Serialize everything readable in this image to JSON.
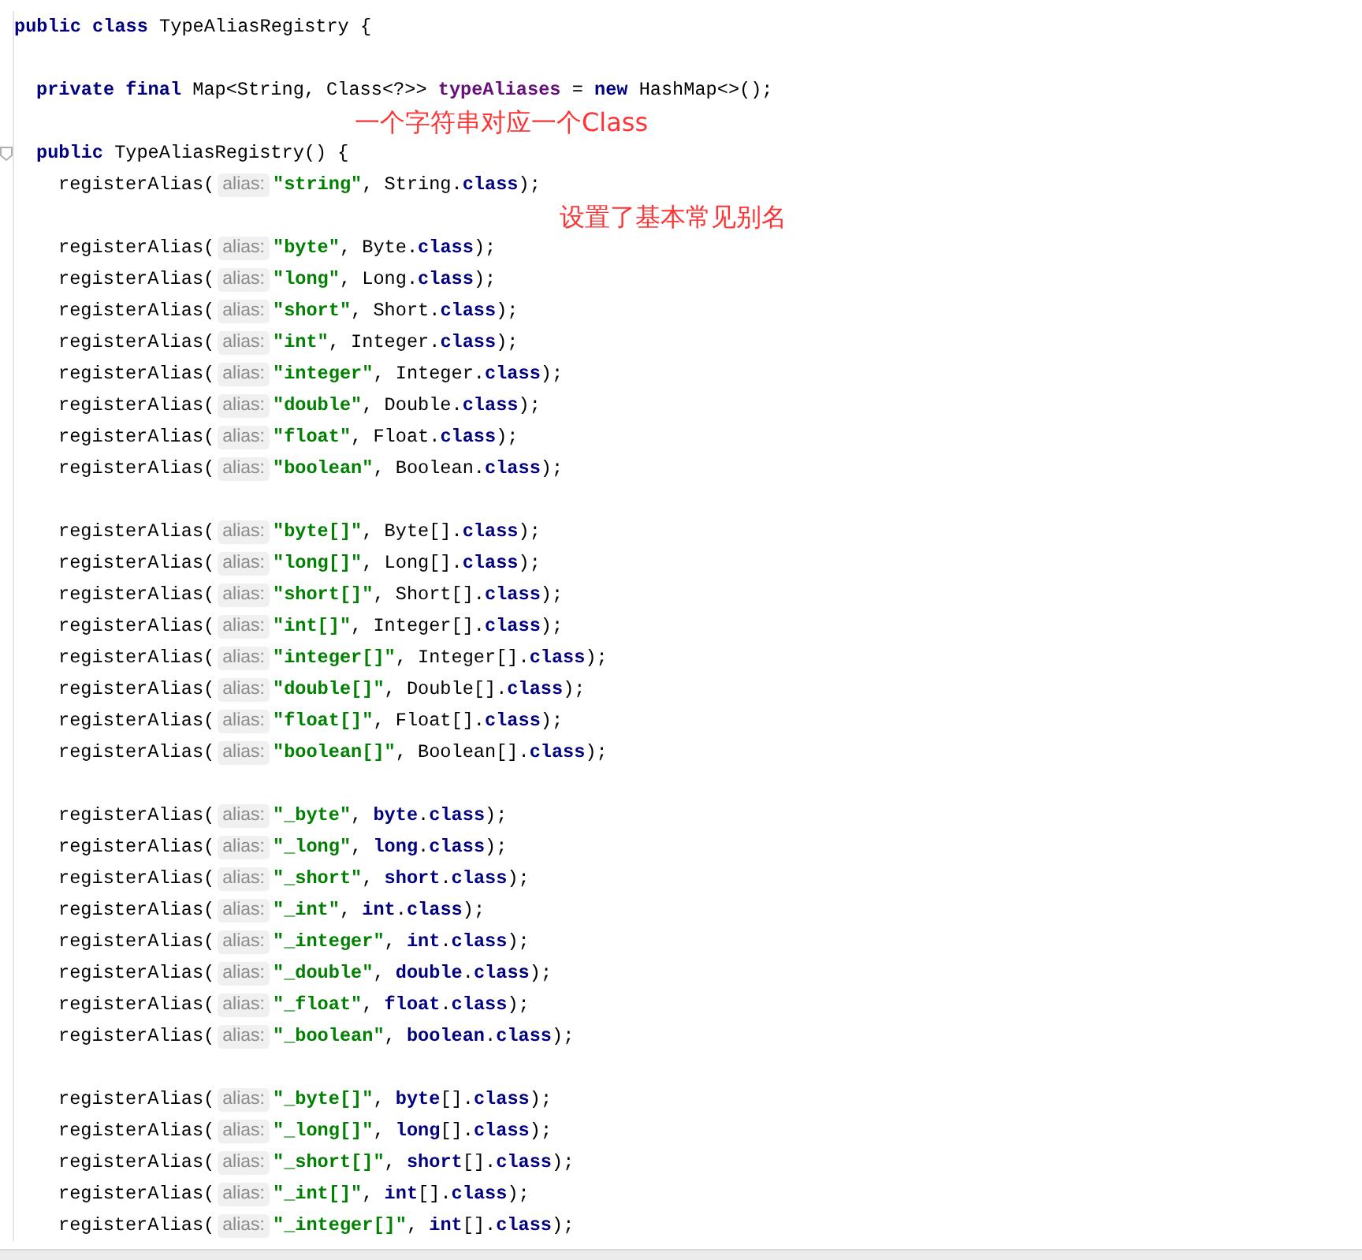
{
  "lines": [
    {
      "kind": "decl",
      "parts": [
        {
          "kind": "keyword",
          "t": "public class"
        },
        {
          "kind": "plain",
          "t": " TypeAliasRegistry {"
        }
      ]
    },
    {
      "kind": "blank"
    },
    {
      "kind": "member",
      "parts": [
        {
          "kind": "keyword",
          "t": "private final"
        },
        {
          "kind": "plain",
          "t": " Map<String, Class<?>> "
        },
        {
          "kind": "field",
          "t": "typeAliases"
        },
        {
          "kind": "plain",
          "t": " = "
        },
        {
          "kind": "keyword",
          "t": "new"
        },
        {
          "kind": "plain",
          "t": " HashMap<>();"
        }
      ]
    },
    {
      "kind": "blank",
      "note": "一个字符串对应一个Class"
    },
    {
      "kind": "ctor",
      "parts": [
        {
          "kind": "keyword",
          "t": "public"
        },
        {
          "kind": "plain",
          "t": " TypeAliasRegistry() {"
        }
      ]
    },
    {
      "kind": "call",
      "name": "registerAlias(",
      "hint": "alias:",
      "parts": [
        {
          "kind": "string",
          "t": "\"string\""
        },
        {
          "kind": "plain",
          "t": ", String."
        },
        {
          "kind": "keyword",
          "t": "class"
        },
        {
          "kind": "plain",
          "t": ");"
        }
      ]
    },
    {
      "kind": "blank",
      "note": "设置了基本常见别名"
    },
    {
      "kind": "call",
      "name": "registerAlias(",
      "hint": "alias:",
      "parts": [
        {
          "kind": "string",
          "t": "\"byte\""
        },
        {
          "kind": "plain",
          "t": ", Byte."
        },
        {
          "kind": "keyword",
          "t": "class"
        },
        {
          "kind": "plain",
          "t": ");"
        }
      ]
    },
    {
      "kind": "call",
      "name": "registerAlias(",
      "hint": "alias:",
      "parts": [
        {
          "kind": "string",
          "t": "\"long\""
        },
        {
          "kind": "plain",
          "t": ", Long."
        },
        {
          "kind": "keyword",
          "t": "class"
        },
        {
          "kind": "plain",
          "t": ");"
        }
      ]
    },
    {
      "kind": "call",
      "name": "registerAlias(",
      "hint": "alias:",
      "parts": [
        {
          "kind": "string",
          "t": "\"short\""
        },
        {
          "kind": "plain",
          "t": ", Short."
        },
        {
          "kind": "keyword",
          "t": "class"
        },
        {
          "kind": "plain",
          "t": ");"
        }
      ]
    },
    {
      "kind": "call",
      "name": "registerAlias(",
      "hint": "alias:",
      "parts": [
        {
          "kind": "string",
          "t": "\"int\""
        },
        {
          "kind": "plain",
          "t": ", Integer."
        },
        {
          "kind": "keyword",
          "t": "class"
        },
        {
          "kind": "plain",
          "t": ");"
        }
      ]
    },
    {
      "kind": "call",
      "name": "registerAlias(",
      "hint": "alias:",
      "parts": [
        {
          "kind": "string",
          "t": "\"integer\""
        },
        {
          "kind": "plain",
          "t": ", Integer."
        },
        {
          "kind": "keyword",
          "t": "class"
        },
        {
          "kind": "plain",
          "t": ");"
        }
      ]
    },
    {
      "kind": "call",
      "name": "registerAlias(",
      "hint": "alias:",
      "parts": [
        {
          "kind": "string",
          "t": "\"double\""
        },
        {
          "kind": "plain",
          "t": ", Double."
        },
        {
          "kind": "keyword",
          "t": "class"
        },
        {
          "kind": "plain",
          "t": ");"
        }
      ]
    },
    {
      "kind": "call",
      "name": "registerAlias(",
      "hint": "alias:",
      "parts": [
        {
          "kind": "string",
          "t": "\"float\""
        },
        {
          "kind": "plain",
          "t": ", Float."
        },
        {
          "kind": "keyword",
          "t": "class"
        },
        {
          "kind": "plain",
          "t": ");"
        }
      ]
    },
    {
      "kind": "call",
      "name": "registerAlias(",
      "hint": "alias:",
      "parts": [
        {
          "kind": "string",
          "t": "\"boolean\""
        },
        {
          "kind": "plain",
          "t": ", Boolean."
        },
        {
          "kind": "keyword",
          "t": "class"
        },
        {
          "kind": "plain",
          "t": ");"
        }
      ]
    },
    {
      "kind": "blank"
    },
    {
      "kind": "call",
      "name": "registerAlias(",
      "hint": "alias:",
      "parts": [
        {
          "kind": "string",
          "t": "\"byte[]\""
        },
        {
          "kind": "plain",
          "t": ", Byte[]."
        },
        {
          "kind": "keyword",
          "t": "class"
        },
        {
          "kind": "plain",
          "t": ");"
        }
      ]
    },
    {
      "kind": "call",
      "name": "registerAlias(",
      "hint": "alias:",
      "parts": [
        {
          "kind": "string",
          "t": "\"long[]\""
        },
        {
          "kind": "plain",
          "t": ", Long[]."
        },
        {
          "kind": "keyword",
          "t": "class"
        },
        {
          "kind": "plain",
          "t": ");"
        }
      ]
    },
    {
      "kind": "call",
      "name": "registerAlias(",
      "hint": "alias:",
      "parts": [
        {
          "kind": "string",
          "t": "\"short[]\""
        },
        {
          "kind": "plain",
          "t": ", Short[]."
        },
        {
          "kind": "keyword",
          "t": "class"
        },
        {
          "kind": "plain",
          "t": ");"
        }
      ]
    },
    {
      "kind": "call",
      "name": "registerAlias(",
      "hint": "alias:",
      "parts": [
        {
          "kind": "string",
          "t": "\"int[]\""
        },
        {
          "kind": "plain",
          "t": ", Integer[]."
        },
        {
          "kind": "keyword",
          "t": "class"
        },
        {
          "kind": "plain",
          "t": ");"
        }
      ]
    },
    {
      "kind": "call",
      "name": "registerAlias(",
      "hint": "alias:",
      "parts": [
        {
          "kind": "string",
          "t": "\"integer[]\""
        },
        {
          "kind": "plain",
          "t": ", Integer[]."
        },
        {
          "kind": "keyword",
          "t": "class"
        },
        {
          "kind": "plain",
          "t": ");"
        }
      ]
    },
    {
      "kind": "call",
      "name": "registerAlias(",
      "hint": "alias:",
      "parts": [
        {
          "kind": "string",
          "t": "\"double[]\""
        },
        {
          "kind": "plain",
          "t": ", Double[]."
        },
        {
          "kind": "keyword",
          "t": "class"
        },
        {
          "kind": "plain",
          "t": ");"
        }
      ]
    },
    {
      "kind": "call",
      "name": "registerAlias(",
      "hint": "alias:",
      "parts": [
        {
          "kind": "string",
          "t": "\"float[]\""
        },
        {
          "kind": "plain",
          "t": ", Float[]."
        },
        {
          "kind": "keyword",
          "t": "class"
        },
        {
          "kind": "plain",
          "t": ");"
        }
      ]
    },
    {
      "kind": "call",
      "name": "registerAlias(",
      "hint": "alias:",
      "parts": [
        {
          "kind": "string",
          "t": "\"boolean[]\""
        },
        {
          "kind": "plain",
          "t": ", Boolean[]."
        },
        {
          "kind": "keyword",
          "t": "class"
        },
        {
          "kind": "plain",
          "t": ");"
        }
      ]
    },
    {
      "kind": "blank"
    },
    {
      "kind": "call",
      "name": "registerAlias(",
      "hint": "alias:",
      "parts": [
        {
          "kind": "string",
          "t": "\"_byte\""
        },
        {
          "kind": "plain",
          "t": ", "
        },
        {
          "kind": "keyword",
          "t": "byte"
        },
        {
          "kind": "plain",
          "t": "."
        },
        {
          "kind": "keyword",
          "t": "class"
        },
        {
          "kind": "plain",
          "t": ");"
        }
      ]
    },
    {
      "kind": "call",
      "name": "registerAlias(",
      "hint": "alias:",
      "parts": [
        {
          "kind": "string",
          "t": "\"_long\""
        },
        {
          "kind": "plain",
          "t": ", "
        },
        {
          "kind": "keyword",
          "t": "long"
        },
        {
          "kind": "plain",
          "t": "."
        },
        {
          "kind": "keyword",
          "t": "class"
        },
        {
          "kind": "plain",
          "t": ");"
        }
      ]
    },
    {
      "kind": "call",
      "name": "registerAlias(",
      "hint": "alias:",
      "parts": [
        {
          "kind": "string",
          "t": "\"_short\""
        },
        {
          "kind": "plain",
          "t": ", "
        },
        {
          "kind": "keyword",
          "t": "short"
        },
        {
          "kind": "plain",
          "t": "."
        },
        {
          "kind": "keyword",
          "t": "class"
        },
        {
          "kind": "plain",
          "t": ");"
        }
      ]
    },
    {
      "kind": "call",
      "name": "registerAlias(",
      "hint": "alias:",
      "parts": [
        {
          "kind": "string",
          "t": "\"_int\""
        },
        {
          "kind": "plain",
          "t": ", "
        },
        {
          "kind": "keyword",
          "t": "int"
        },
        {
          "kind": "plain",
          "t": "."
        },
        {
          "kind": "keyword",
          "t": "class"
        },
        {
          "kind": "plain",
          "t": ");"
        }
      ]
    },
    {
      "kind": "call",
      "name": "registerAlias(",
      "hint": "alias:",
      "parts": [
        {
          "kind": "string",
          "t": "\"_integer\""
        },
        {
          "kind": "plain",
          "t": ", "
        },
        {
          "kind": "keyword",
          "t": "int"
        },
        {
          "kind": "plain",
          "t": "."
        },
        {
          "kind": "keyword",
          "t": "class"
        },
        {
          "kind": "plain",
          "t": ");"
        }
      ]
    },
    {
      "kind": "call",
      "name": "registerAlias(",
      "hint": "alias:",
      "parts": [
        {
          "kind": "string",
          "t": "\"_double\""
        },
        {
          "kind": "plain",
          "t": ", "
        },
        {
          "kind": "keyword",
          "t": "double"
        },
        {
          "kind": "plain",
          "t": "."
        },
        {
          "kind": "keyword",
          "t": "class"
        },
        {
          "kind": "plain",
          "t": ");"
        }
      ]
    },
    {
      "kind": "call",
      "name": "registerAlias(",
      "hint": "alias:",
      "parts": [
        {
          "kind": "string",
          "t": "\"_float\""
        },
        {
          "kind": "plain",
          "t": ", "
        },
        {
          "kind": "keyword",
          "t": "float"
        },
        {
          "kind": "plain",
          "t": "."
        },
        {
          "kind": "keyword",
          "t": "class"
        },
        {
          "kind": "plain",
          "t": ");"
        }
      ]
    },
    {
      "kind": "call",
      "name": "registerAlias(",
      "hint": "alias:",
      "parts": [
        {
          "kind": "string",
          "t": "\"_boolean\""
        },
        {
          "kind": "plain",
          "t": ", "
        },
        {
          "kind": "keyword",
          "t": "boolean"
        },
        {
          "kind": "plain",
          "t": "."
        },
        {
          "kind": "keyword",
          "t": "class"
        },
        {
          "kind": "plain",
          "t": ");"
        }
      ]
    },
    {
      "kind": "blank"
    },
    {
      "kind": "call",
      "name": "registerAlias(",
      "hint": "alias:",
      "parts": [
        {
          "kind": "string",
          "t": "\"_byte[]\""
        },
        {
          "kind": "plain",
          "t": ", "
        },
        {
          "kind": "keyword",
          "t": "byte"
        },
        {
          "kind": "plain",
          "t": "[]."
        },
        {
          "kind": "keyword",
          "t": "class"
        },
        {
          "kind": "plain",
          "t": ");"
        }
      ]
    },
    {
      "kind": "call",
      "name": "registerAlias(",
      "hint": "alias:",
      "parts": [
        {
          "kind": "string",
          "t": "\"_long[]\""
        },
        {
          "kind": "plain",
          "t": ", "
        },
        {
          "kind": "keyword",
          "t": "long"
        },
        {
          "kind": "plain",
          "t": "[]."
        },
        {
          "kind": "keyword",
          "t": "class"
        },
        {
          "kind": "plain",
          "t": ");"
        }
      ]
    },
    {
      "kind": "call",
      "name": "registerAlias(",
      "hint": "alias:",
      "parts": [
        {
          "kind": "string",
          "t": "\"_short[]\""
        },
        {
          "kind": "plain",
          "t": ", "
        },
        {
          "kind": "keyword",
          "t": "short"
        },
        {
          "kind": "plain",
          "t": "[]."
        },
        {
          "kind": "keyword",
          "t": "class"
        },
        {
          "kind": "plain",
          "t": ");"
        }
      ]
    },
    {
      "kind": "call",
      "name": "registerAlias(",
      "hint": "alias:",
      "parts": [
        {
          "kind": "string",
          "t": "\"_int[]\""
        },
        {
          "kind": "plain",
          "t": ", "
        },
        {
          "kind": "keyword",
          "t": "int"
        },
        {
          "kind": "plain",
          "t": "[]."
        },
        {
          "kind": "keyword",
          "t": "class"
        },
        {
          "kind": "plain",
          "t": ");"
        }
      ]
    },
    {
      "kind": "call",
      "name": "registerAlias(",
      "hint": "alias:",
      "parts": [
        {
          "kind": "string",
          "t": "\"_integer[]\""
        },
        {
          "kind": "plain",
          "t": ", "
        },
        {
          "kind": "keyword",
          "t": "int"
        },
        {
          "kind": "plain",
          "t": "[]."
        },
        {
          "kind": "keyword",
          "t": "class"
        },
        {
          "kind": "plain",
          "t": ");"
        }
      ]
    }
  ]
}
